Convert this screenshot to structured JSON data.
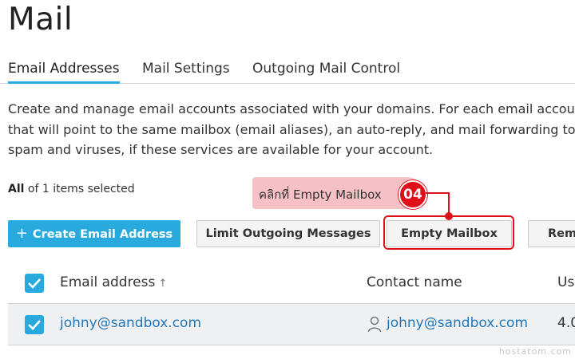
{
  "page": {
    "title": "Mail"
  },
  "tabs": [
    {
      "label": "Email Addresses",
      "active": true
    },
    {
      "label": "Mail Settings",
      "active": false
    },
    {
      "label": "Outgoing Mail Control",
      "active": false
    }
  ],
  "description": {
    "line1": "Create and manage email accounts associated with your domains. For each email accou",
    "line2": "that will point to the same mailbox (email aliases), an auto-reply, and mail forwarding to",
    "line3": "spam and viruses, if these services are available for your account."
  },
  "selection": {
    "all": "All",
    "rest": " of 1 items selected"
  },
  "callout": {
    "text": "คลิกที่ Empty Mailbox",
    "step": "04"
  },
  "toolbar": {
    "create_label": "Create Email Address",
    "create_icon": "+",
    "limit_label": "Limit Outgoing Messages",
    "empty_label": "Empty Mailbox",
    "remove_label": "Rem"
  },
  "table": {
    "headers": {
      "email": "Email address",
      "email_sort_icon": "↑",
      "contact": "Contact name",
      "usage": "Us"
    },
    "rows": [
      {
        "email": "johny@sandbox.com",
        "contact": "johny@sandbox.com",
        "usage": "4.0",
        "selected": true
      }
    ]
  },
  "watermark": "hostatom.com",
  "colors": {
    "accent": "#28aade",
    "highlight": "#e0101b",
    "callout_bg": "#f7c0c6",
    "link": "#2277bb"
  }
}
